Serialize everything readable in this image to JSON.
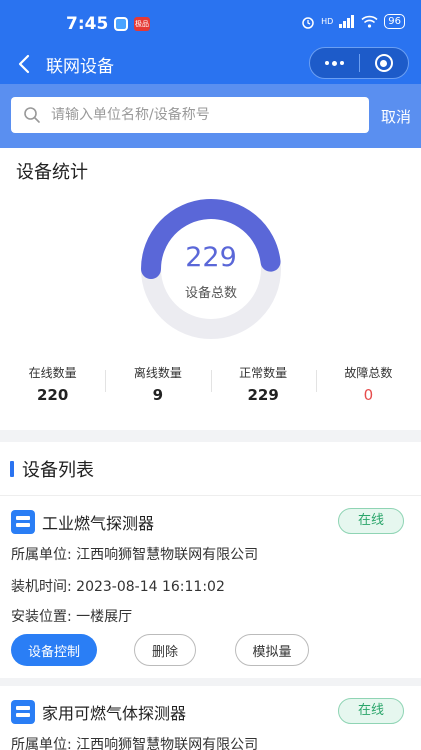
{
  "status_bar": {
    "time": "7:45",
    "app_badge": "极品",
    "hd": "HD",
    "battery": "96"
  },
  "header": {
    "title": "联网设备"
  },
  "search": {
    "placeholder": "请输入单位名称/设备称号",
    "cancel_label": "取消"
  },
  "stats": {
    "title": "设备统计",
    "total_value": "229",
    "total_label": "设备总数",
    "online_fraction": 0.961,
    "items": [
      {
        "label": "在线数量",
        "value": "220"
      },
      {
        "label": "离线数量",
        "value": "9"
      },
      {
        "label": "正常数量",
        "value": "229"
      },
      {
        "label": "故障总数",
        "value": "0"
      }
    ]
  },
  "device_list": {
    "title": "设备列表",
    "devices": [
      {
        "name": "工业燃气探测器",
        "status": "在线",
        "unit_label": "所属单位:",
        "unit": "江西响狮智慧物联网有限公司",
        "install_label": "装机时间:",
        "install_time": "2023-08-14 16:11:02",
        "location_label": "安装位置:",
        "location": "一楼展厅",
        "buttons": {
          "control": "设备控制",
          "delete": "删除",
          "simulate": "模拟量"
        }
      },
      {
        "name": "家用可燃气体探测器",
        "status": "在线",
        "unit_label": "所属单位:",
        "unit": "江西响狮智慧物联网有限公司"
      }
    ]
  },
  "colors": {
    "primary": "#2a73f0",
    "gauge": "#5a67d8",
    "online": "#2aa56a",
    "fault": "#e64c4c"
  }
}
